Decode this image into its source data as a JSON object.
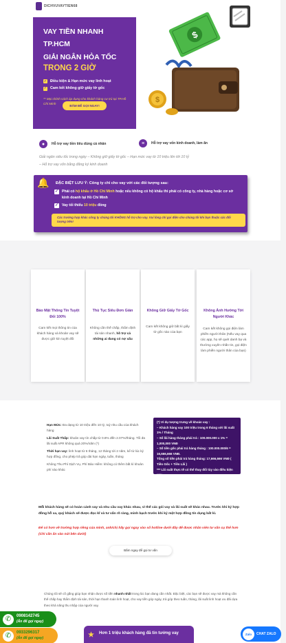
{
  "brand": {
    "logo_text": "DICHVUVAYTIEN68"
  },
  "hero": {
    "title_line1": "VAY TIỀN NHANH TP.HCM",
    "title_line2": "GIẢI NGÂN HỎA TỐC",
    "highlight": "TRONG 2 GIỜ",
    "checks": [
      "Điều kiện & Hạn mức vay linh hoạt",
      "Cam kết không giữ giấy tờ gốc"
    ],
    "note": "** Mọi chính sách áp dụng cho khách hàng cư trú tại TP.Hồ Chí Minh",
    "cta": "BẤM ĐỂ GỌI NGAY!"
  },
  "features": [
    {
      "label": "Hỗ trợ vay tiền tiêu dùng cá nhân",
      "icon": "person-icon"
    },
    {
      "label": "Hỗ trợ vay vốn kinh doanh, làm ăn",
      "icon": "coins-icon"
    }
  ],
  "subtext": {
    "line1": "Giải ngân siêu tốc trong ngày – Không giữ giấy tờ gốc – Hạn mức vay từ 10 triệu lên tới 10 tỷ",
    "line2": "– Hỗ trợ vay vốn bằng đăng ký kinh doanh"
  },
  "notice": {
    "title": "ĐẶC BIỆT LƯU Ý: Công ty chỉ cho vay với các đối tượng sau:",
    "row1_a": "Phải có ",
    "row1_b": "hộ khẩu ở Hồ Chí Minh",
    "row1_c": " hoặc nếu không có hộ khẩu thì phải có công ty, nhà hàng hoặc cơ sở kinh doanh tại Hồ Chí Minh",
    "row2_a": "Vay tối thiểu ",
    "row2_b": "10 triệu",
    "row2_c": " đồng",
    "bar": "Các trường hợp khác công ty chúng tôi KHÔNG hỗ trợ cho vay. Vui lòng chỉ gọi điện cho chúng tôi khi bạn thuộc các đối tượng trên!"
  },
  "cards": [
    {
      "title": "Bảo Mật Thông Tin Tuyệt Đối 100%",
      "desc": "Cam kết mọi thông tin của khách hàng và khoản vay sẽ được giữ kín tuyệt đối"
    },
    {
      "title": "Thủ Tục Siêu Đơn Giản",
      "desc": "Không cần thế chấp, thẩm định tài sản nhanh, ",
      "desc_bold": "hồ trợ cả những ai đang có nợ xấu"
    },
    {
      "title": "Không Giữ Giấy Tờ Gốc",
      "desc": "Cam kết không giữ bất kì giấy tờ gốc nào của bạn"
    },
    {
      "title": "Không Ảnh Hưởng Tới Người Khác",
      "desc": "Cam kết không gọi điện làm phiền người thân (Nếu vay qua các app, họ sẽ quét danh bạ và thường xuyên nhắn tin, gọi điện làm phiền người thân của bạn)"
    }
  ],
  "loan_info": {
    "limit_label": "Hạn Mức:",
    "limit_text": " Đa dạng từ 10 triệu đến 10 tỷ, tuỳ nhu cầu của khách hàng",
    "rate_label": "Lãi Suất Thấp:",
    "rate_text": " khoản vay tín chấp từ 0.8% đến 2.07%/tháng. Tối đa lãi suất APR không quá 20%/năm (*)",
    "term_label": "Thời hạn vay:",
    "term_text": " linh hoạt từ 6 tháng, 12 tháng tới 2 năm, kể từ lúc ký hợp đồng, cho phép trả góp dài hạn ngày, tuần, tháng",
    "extra": "Không Thu Phí Dịch Vụ, Phí Bảo Hiểm: không có thêm bất kì khoản phí nào khác"
  },
  "example": {
    "lines": [
      "(*) Ví dụ tượng trưng về khoản vay :",
      "– Khách hàng vay 100 triệu trong 6 tháng với lãi suất 1% / Tháng",
      "– Số lãi hàng tháng phải trả : 100.000.000 x 1% = 1,000,000 VNĐ",
      "– Số tiền gốc phải trả hàng tháng : 100.000.000/6 = 16,666,666 VNĐ.",
      "Tổng số tiền phải trả hàng tháng: 17,666,666 VNĐ ( Tiền Gốc + Tiền Lãi )",
      "*** Lãi suất thực tế có thể thay đổi tùy vào điều kiện vay."
    ]
  },
  "support": {
    "text": "Mỗi khách hàng sẽ có hoàn cảnh vay và nhu cầu vay khác nhau, vì thế các gói vay và lãi suất sẽ khác nhau. Trước khi ký hợp đồng hỗ xa, quý khách sẽ được đọc kĩ và tư vấn rõ ràng, minh bạch trước khi ký một hợp đồng tín dụng bất kì.",
    "red": "Để có hơn về trường hợp riêng của mình, anh/chị hãy gọi ngay vào số hotline dưới đây để được nhân viên tư vấn cụ thể hơn (Chỉ cần ấn vào nút bên dưới)",
    "button": "Bấm ngay để gọi tư vấn"
  },
  "intro": {
    "a": "Chúng tôi sẽ cố gắng giúp bạn nhận được số tiền ",
    "b": "nhanh nhất",
    "c": " trong lúc bạn đang cần nhất. Đặc biệt, các bạn sẽ được vay mà không cần thế chấp hay thẩm định tài sản, thời hạn thanh toán linh hoạt, cho vay tiền góp ngày, trả góp theo tuần, tháng, lãi suất linh hoạt ưu đãi dựa theo khả năng thu nhập của người vay."
  },
  "calls": [
    {
      "phone": "0908142745",
      "note": "(Ấn để gọi ngay)"
    },
    {
      "phone": "0933296317",
      "note": "(Ấn để gọi ngay)"
    }
  ],
  "bottom_banner": {
    "text": "Hơn 1 triệu khách hàng đã tin tưởng vay"
  },
  "zalo": {
    "icon_label": "Zalo",
    "text": "CHAT ZALO"
  },
  "colors": {
    "purple": "#6b2fa0",
    "yellow": "#ffd84a",
    "dark": "#3e1367",
    "green": "#1a8f1a",
    "orange": "#f6a623",
    "zalo": "#1678ff"
  }
}
